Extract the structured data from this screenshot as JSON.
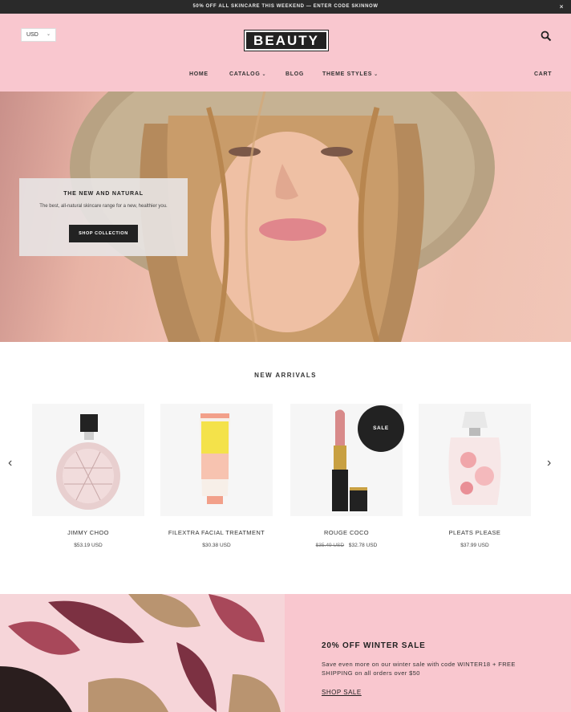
{
  "announcement": {
    "text": "50% OFF ALL SKINCARE THIS WEEKEND — ENTER CODE SKINNOW",
    "close": "×"
  },
  "header": {
    "currency": "USD",
    "logo": "BEAUTY",
    "nav": {
      "home": "HOME",
      "catalog": "CATALOG",
      "blog": "BLOG",
      "theme_styles": "THEME STYLES",
      "cart": "CART"
    }
  },
  "hero": {
    "title": "THE NEW AND NATURAL",
    "text": "The best, all-natural skincare range for a new, healthier you.",
    "button": "SHOP COLLECTION"
  },
  "arrivals": {
    "title": "NEW ARRIVALS",
    "products": [
      {
        "name": "JIMMY CHOO",
        "price": "$53.19 USD"
      },
      {
        "name": "FILEXTRA FACIAL TREATMENT",
        "price": "$30.38 USD"
      },
      {
        "name": "ROUGE COCO",
        "old_price": "$35.49 USD",
        "price": "$32.78 USD",
        "badge": "SALE"
      },
      {
        "name": "PLEATS PLEASE",
        "price": "$37.99 USD"
      }
    ]
  },
  "promo": {
    "title": "20% OFF WINTER SALE",
    "text": "Save even more on our winter sale with code WINTER18 + FREE SHIPPING on all orders over $50",
    "link": "SHOP SALE"
  },
  "colors": {
    "header_pink": "#f9c7cf",
    "dark": "#222222"
  }
}
